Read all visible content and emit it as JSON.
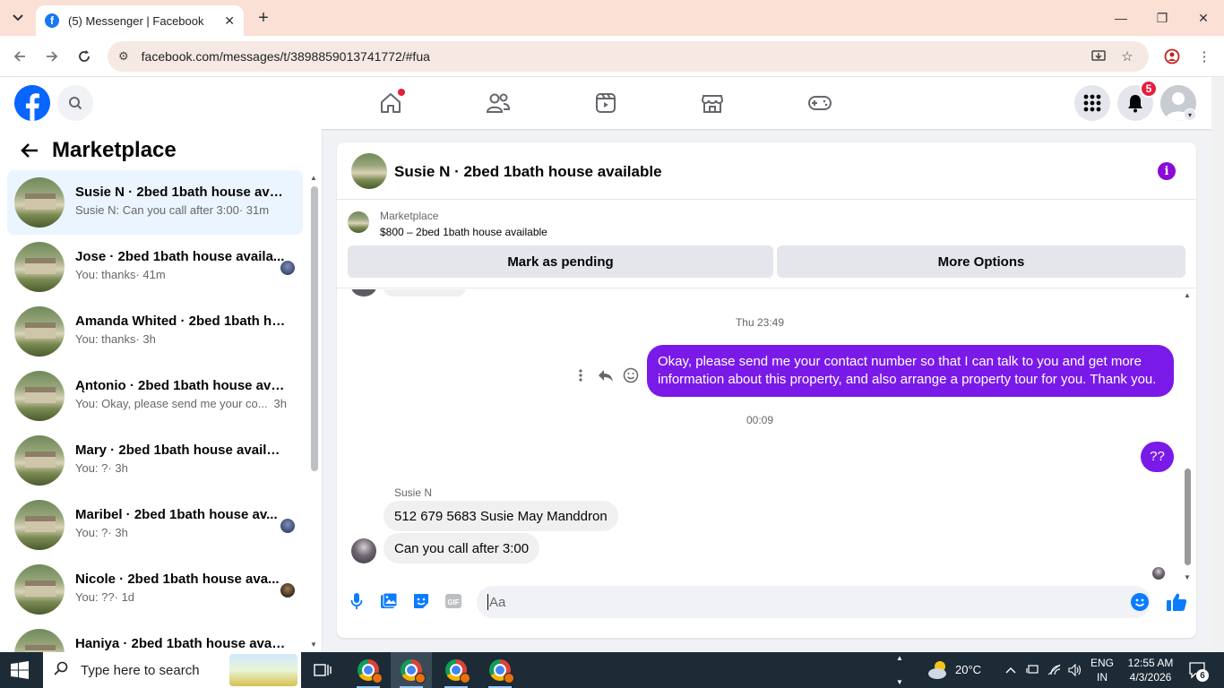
{
  "browser": {
    "tab_title": "(5) Messenger | Facebook",
    "url": "facebook.com/messages/t/3898859013741772/#fua"
  },
  "header": {
    "notification_count": "5"
  },
  "sidebar": {
    "title": "Marketplace",
    "conversations": [
      {
        "name": "Susie N · 2bed 1bath house avail...",
        "preview": "Susie N: Can you call after 3:00",
        "time": "· 31m",
        "active": true
      },
      {
        "name": "Jose · 2bed 1bath house availa...",
        "preview": "You: thanks",
        "time": "· 41m"
      },
      {
        "name": "Amanda Whited · 2bed 1bath ho...",
        "preview": "You: thanks",
        "time": "· 3h"
      },
      {
        "name": "Ąntonio · 2bed 1bath house avai...",
        "preview": "You: Okay, please send me your co...",
        "time": "3h"
      },
      {
        "name": "Mary · 2bed 1bath house available",
        "preview": "You: ?",
        "time": "· 3h"
      },
      {
        "name": "Maribel · 2bed 1bath house av...",
        "preview": "You: ?",
        "time": "· 3h"
      },
      {
        "name": "Nicole · 2bed 1bath house ava...",
        "preview": "You: ??",
        "time": "· 1d"
      },
      {
        "name": "Haniya · 2bed 1bath house avail...",
        "preview": "",
        "time": ""
      }
    ]
  },
  "chat": {
    "title": "Susie N · 2bed 1bath house available",
    "listing": {
      "label": "Marketplace",
      "price_title": "$800 – 2bed 1bath house available",
      "pending_button": "Mark as pending",
      "more_button": "More Options"
    },
    "messages": {
      "ts1": "Thu 23:49",
      "out1": "Okay, please send me your contact number so that I can talk to you and get more information about this property, and also arrange a property tour for you. Thank you.",
      "ts2": "00:09",
      "out2": "??",
      "sender": "Susie N",
      "in1": "512 679 5683 Susie May Manddron",
      "in2": "Can you call after 3:00"
    },
    "composer": {
      "placeholder": "Aa"
    }
  },
  "taskbar": {
    "search_placeholder": "Type here to search",
    "temperature": "20°C",
    "lang1": "ENG",
    "lang2": "IN",
    "time": "12:55 AM",
    "date": "4/3/2026",
    "notif_count": "6"
  },
  "colors": {
    "fb_blue": "#0866ff",
    "messenger_purple": "#7a1ae8",
    "notification_red": "#e41e3f",
    "taskbar": "#1c2b36"
  }
}
